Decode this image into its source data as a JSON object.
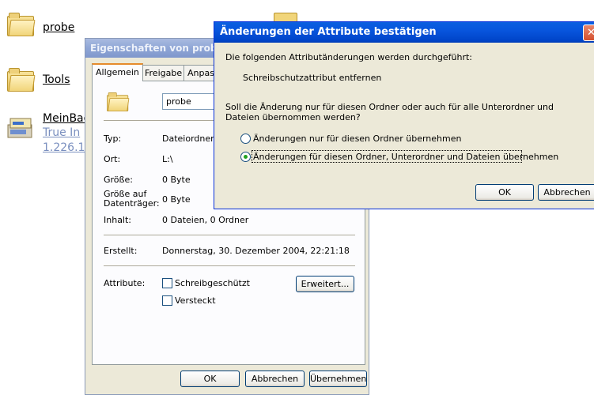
{
  "desktop": {
    "items": [
      {
        "label": "probe",
        "icon": "folder-icon"
      },
      {
        "label": "Tools",
        "icon": "folder-icon"
      },
      {
        "label": "MeinBac",
        "sub1": "True In",
        "sub2": "1.226.1",
        "icon": "backup-file-icon"
      }
    ]
  },
  "properties": {
    "title": "Eigenschaften von probe",
    "tabs": [
      "Allgemein",
      "Freigabe",
      "Anpasse"
    ],
    "name_value": "probe",
    "rows": {
      "typ_label": "Typ:",
      "typ_value": "Dateiordner",
      "ort_label": "Ort:",
      "ort_value": "L:\\",
      "groesse_label": "Größe:",
      "groesse_value": "0 Byte",
      "groesse_auf_label": "Größe auf Datenträger:",
      "groesse_auf_value": "0 Byte",
      "inhalt_label": "Inhalt:",
      "inhalt_value": "0 Dateien, 0 Ordner",
      "erstellt_label": "Erstellt:",
      "erstellt_value": "Donnerstag, 30. Dezember 2004, 22:21:18",
      "attribute_label": "Attribute:"
    },
    "attributes": {
      "readonly_label": "Schreibgeschützt",
      "readonly_checked": false,
      "hidden_label": "Versteckt",
      "hidden_checked": false,
      "advanced_button": "Erweitert..."
    },
    "buttons": {
      "ok": "OK",
      "cancel": "Abbrechen",
      "apply": "Übernehmen"
    }
  },
  "confirm": {
    "title": "Änderungen der Attribute bestätigen",
    "close_glyph": "✕",
    "line1": "Die folgenden Attributänderungen werden durchgeführt:",
    "change": "Schreibschutzattribut entfernen",
    "question_line1": "Soll die Änderung nur für diesen Ordner oder auch für alle Unterordner und",
    "question_line2": "Dateien übernommen werden?",
    "options": [
      {
        "label": "Änderungen nur für diesen Ordner übernehmen",
        "selected": false
      },
      {
        "label": "Änderungen für diesen Ordner, Unterordner und Dateien übernehmen",
        "selected": true
      }
    ],
    "buttons": {
      "ok": "OK",
      "cancel": "Abbrechen"
    }
  },
  "colors": {
    "xp_title_blue": "#0a5fe0",
    "inactive_title": "#8fa6d6",
    "dialog_face": "#ece9d8",
    "close_red": "#d3502f"
  }
}
